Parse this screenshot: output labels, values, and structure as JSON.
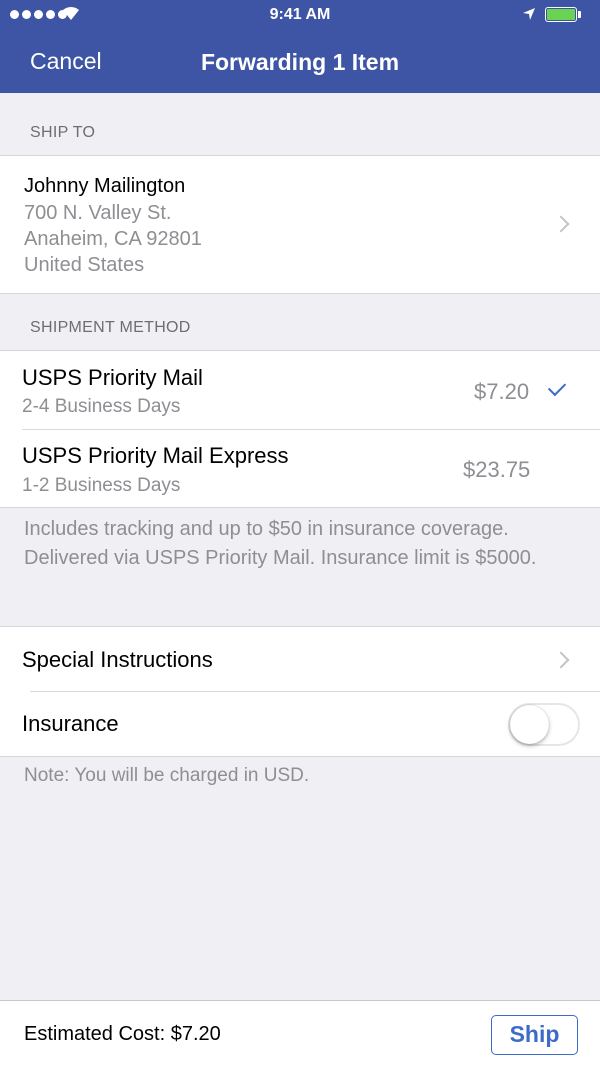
{
  "status_bar": {
    "time": "9:41 AM",
    "signal_icon": "signal-dots-icon",
    "wifi_icon": "wifi-icon",
    "location_icon": "location-arrow-icon",
    "battery_icon": "battery-icon",
    "battery_color": "#6bd352"
  },
  "nav": {
    "cancel_label": "Cancel",
    "title": "Forwarding 1 Item",
    "background_color": "#3d55a4"
  },
  "ship_to": {
    "header": "SHIP TO",
    "name": "Johnny Mailington",
    "address_lines": [
      "700 N. Valley St.",
      "Anaheim, CA 92801",
      "United States"
    ],
    "chevron_icon": "chevron-right-icon"
  },
  "shipment_method": {
    "header": "SHIPMENT METHOD",
    "options": [
      {
        "title": "USPS Priority Mail",
        "subtitle": "2-4 Business Days",
        "price": "$7.20",
        "selected": true
      },
      {
        "title": "USPS Priority Mail Express",
        "subtitle": "1-2 Business Days",
        "price": "$23.75",
        "selected": false
      }
    ],
    "check_icon": "checkmark-icon",
    "info": "Includes tracking and up to $50 in insurance coverage. Delivered via USPS Priority Mail. Insurance limit is $5000."
  },
  "extras": {
    "special_instructions_label": "Special Instructions",
    "insurance_label": "Insurance",
    "insurance_enabled": false
  },
  "note": "Note: You will be charged in USD.",
  "footer": {
    "estimated_cost": "Estimated Cost: $7.20",
    "ship_label": "Ship",
    "accent_color": "#3d6bc9"
  }
}
